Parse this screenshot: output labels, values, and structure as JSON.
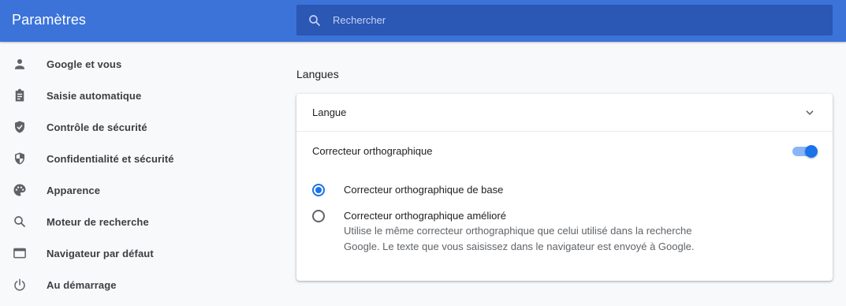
{
  "header": {
    "title": "Paramètres",
    "search_placeholder": "Rechercher",
    "search_value": ""
  },
  "sidebar": {
    "items": [
      {
        "label": "Google et vous",
        "icon": "person-icon"
      },
      {
        "label": "Saisie automatique",
        "icon": "clipboard-icon"
      },
      {
        "label": "Contrôle de sécurité",
        "icon": "shield-check-icon"
      },
      {
        "label": "Confidentialité et sécurité",
        "icon": "shield-half-icon"
      },
      {
        "label": "Apparence",
        "icon": "palette-icon"
      },
      {
        "label": "Moteur de recherche",
        "icon": "search-icon"
      },
      {
        "label": "Navigateur par défaut",
        "icon": "browser-icon"
      },
      {
        "label": "Au démarrage",
        "icon": "power-icon"
      }
    ]
  },
  "main": {
    "section_title": "Langues",
    "language_row": {
      "label": "Langue"
    },
    "spellcheck": {
      "label": "Correcteur orthographique",
      "enabled": true,
      "options": [
        {
          "label": "Correcteur orthographique de base",
          "selected": true
        },
        {
          "label": "Correcteur orthographique amélioré",
          "selected": false,
          "description": "Utilise le même correcteur orthographique que celui utilisé dans la recherche Google. Le texte que vous saisissez dans le navigateur est envoyé à Google."
        }
      ]
    }
  },
  "colors": {
    "header_bg": "#3b73d9",
    "search_bg": "#2b57b5",
    "accent": "#1a73e8",
    "toggle_track": "#8ab4f8",
    "page_bg": "#f8f9fa"
  }
}
